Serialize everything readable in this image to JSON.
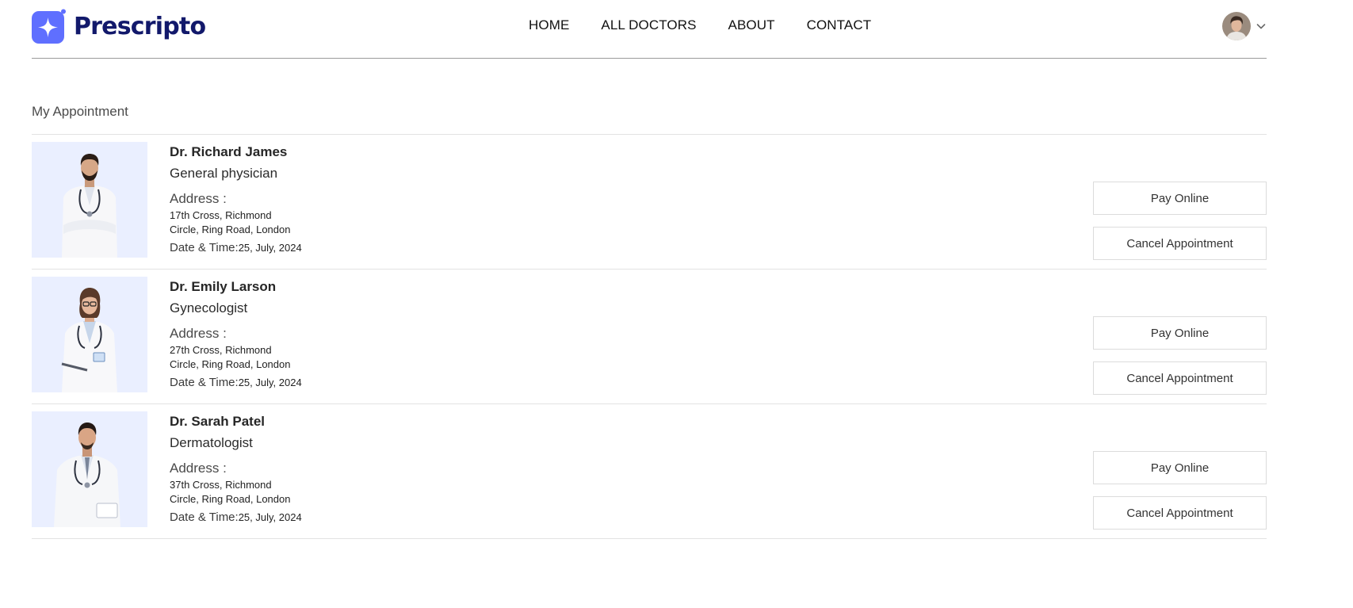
{
  "brand": {
    "name": "Prescripto",
    "color": "#12196b",
    "accent": "#5f6fff"
  },
  "nav": {
    "items": [
      {
        "label": "HOME"
      },
      {
        "label": "ALL DOCTORS"
      },
      {
        "label": "ABOUT"
      },
      {
        "label": "CONTACT"
      }
    ]
  },
  "profile": {
    "avatar_icon": "user-avatar",
    "dropdown_icon": "chevron-down-icon"
  },
  "page": {
    "title": "My Appointment"
  },
  "appointments": [
    {
      "name": "Dr. Richard James",
      "speciality": "General physician",
      "address_label": "Address :",
      "address_line1": "17th Cross, Richmond",
      "address_line2": "Circle, Ring Road, London",
      "datetime_label": "Date & Time:",
      "datetime_value": "25, July, 2024",
      "pay_label": "Pay Online",
      "cancel_label": "Cancel Appointment"
    },
    {
      "name": "Dr. Emily Larson",
      "speciality": "Gynecologist",
      "address_label": "Address :",
      "address_line1": "27th Cross, Richmond",
      "address_line2": "Circle, Ring Road, London",
      "datetime_label": "Date & Time:",
      "datetime_value": "25, July, 2024",
      "pay_label": "Pay Online",
      "cancel_label": "Cancel Appointment"
    },
    {
      "name": "Dr. Sarah Patel",
      "speciality": "Dermatologist",
      "address_label": "Address :",
      "address_line1": "37th Cross, Richmond",
      "address_line2": "Circle, Ring Road, London",
      "datetime_label": "Date & Time:",
      "datetime_value": "25, July, 2024",
      "pay_label": "Pay Online",
      "cancel_label": "Cancel Appointment"
    }
  ]
}
